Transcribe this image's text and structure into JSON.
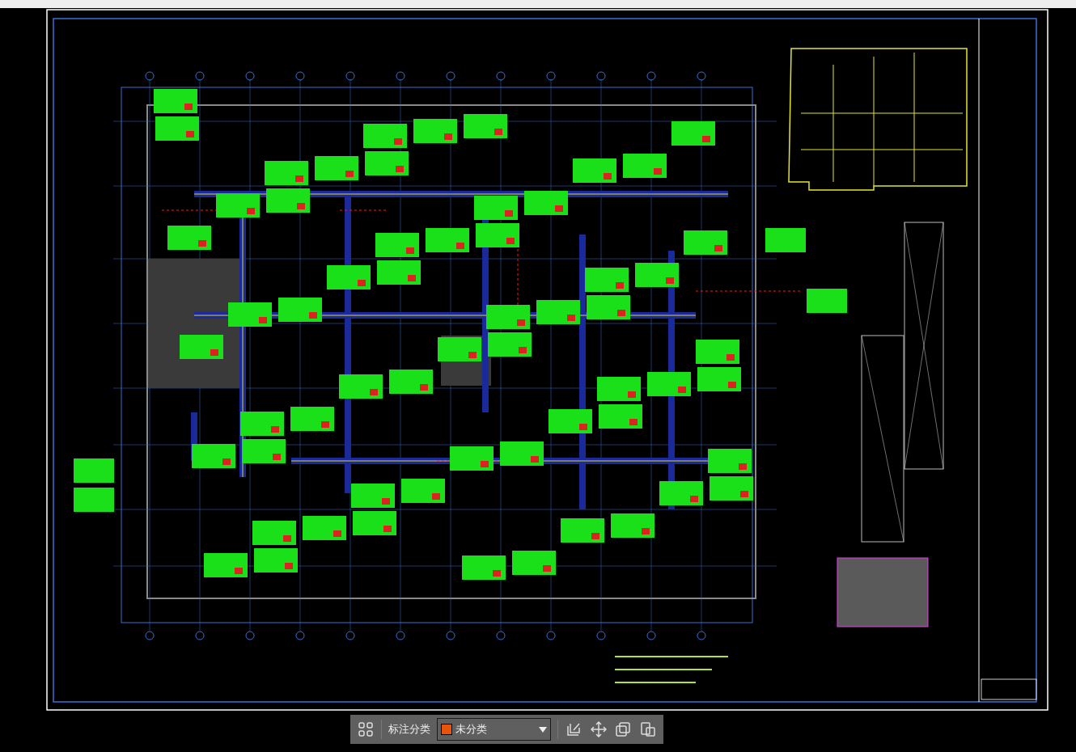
{
  "toolbar": {
    "label": "标注分类",
    "category": {
      "value": "未分类",
      "color": "#e8530e"
    }
  }
}
